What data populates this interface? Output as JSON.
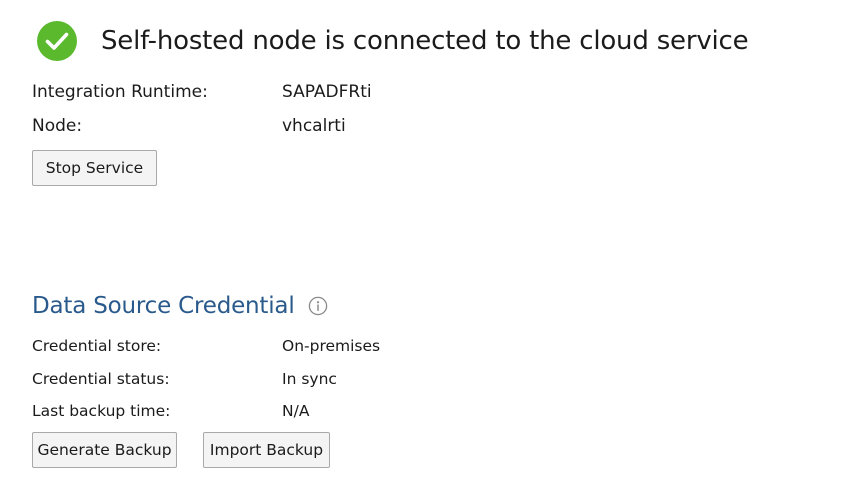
{
  "status": {
    "title": "Self-hosted node is connected to the cloud service",
    "icon": "check-circle-icon",
    "color": "#5bb92e"
  },
  "node_info": {
    "integration_runtime_label": "Integration Runtime:",
    "integration_runtime_value": "SAPADFRti",
    "node_label": "Node:",
    "node_value": "vhcalrti"
  },
  "actions": {
    "stop_service_label": "Stop Service"
  },
  "credential_section": {
    "title": "Data Source Credential",
    "info_icon": "info-icon",
    "title_color": "#2a5a8c",
    "store_label": "Credential store:",
    "store_value": "On-premises",
    "status_label": "Credential status:",
    "status_value": "In sync",
    "backup_time_label": "Last backup time:",
    "backup_time_value": "N/A",
    "generate_backup_label": "Generate Backup",
    "import_backup_label": "Import Backup"
  }
}
